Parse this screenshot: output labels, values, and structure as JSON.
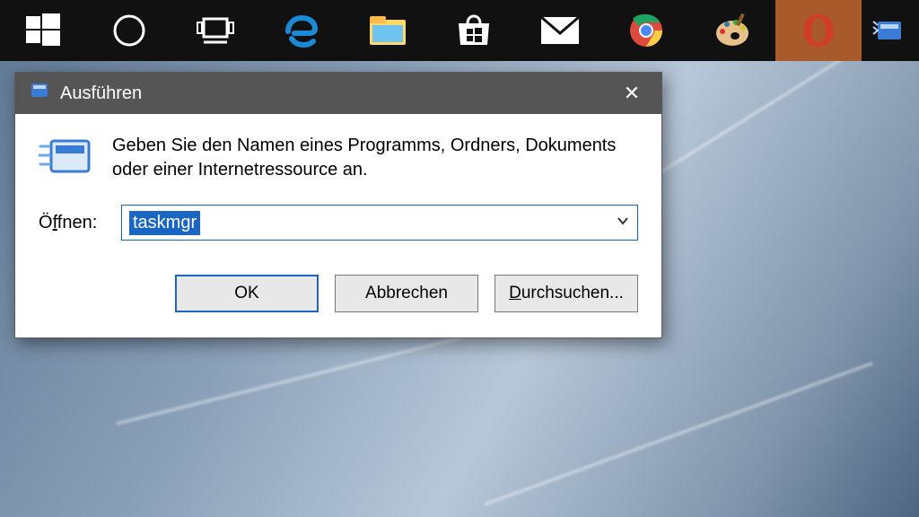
{
  "dialog": {
    "title": "Ausführen",
    "description": "Geben Sie den Namen eines Programms, Ordners, Dokuments oder einer Internetressource an.",
    "open_label_pre": "Ö",
    "open_label_ul": "f",
    "open_label_post": "fnen:",
    "input_value": "taskmgr",
    "ok_label": "OK",
    "cancel_label": "Abbrechen",
    "browse_pre": "",
    "browse_ul": "D",
    "browse_post": "urchsuchen...",
    "close_glyph": "✕"
  },
  "taskbar": {
    "items": [
      {
        "name": "start-icon"
      },
      {
        "name": "cortana-icon"
      },
      {
        "name": "taskview-icon"
      },
      {
        "name": "edge-icon"
      },
      {
        "name": "explorer-icon"
      },
      {
        "name": "store-icon"
      },
      {
        "name": "mail-icon"
      },
      {
        "name": "chrome-icon"
      },
      {
        "name": "paint-icon"
      },
      {
        "name": "opera-icon"
      },
      {
        "name": "run-icon"
      }
    ],
    "active_index": 9
  }
}
